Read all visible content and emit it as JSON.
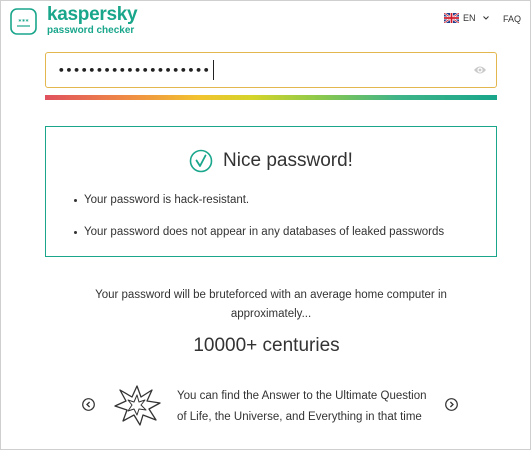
{
  "header": {
    "brand_name": "kaspersky",
    "brand_sub": "password checker",
    "language": "EN",
    "faq_label": "FAQ"
  },
  "password_field": {
    "masked_value": "••••••••••••••••••••"
  },
  "result": {
    "title": "Nice password!",
    "bullets": [
      "Your password is hack-resistant.",
      "Your password does not appear in any databases of leaked passwords"
    ]
  },
  "bruteforce": {
    "text": "Your password will be bruteforced with an average home computer in approximately...",
    "duration": "10000+ centuries"
  },
  "carousel": {
    "fact": "You can find the Answer to the Ultimate Question of Life, the Universe, and Everything in that time"
  },
  "colors": {
    "brand": "#19a68b",
    "input_border": "#e3b64e"
  },
  "icons": [
    "kaspersky-logo-icon",
    "uk-flag-icon",
    "chevron-down-icon",
    "eye-icon",
    "check-circle-icon",
    "arrow-left-icon",
    "arrow-right-icon",
    "burst-icon"
  ]
}
